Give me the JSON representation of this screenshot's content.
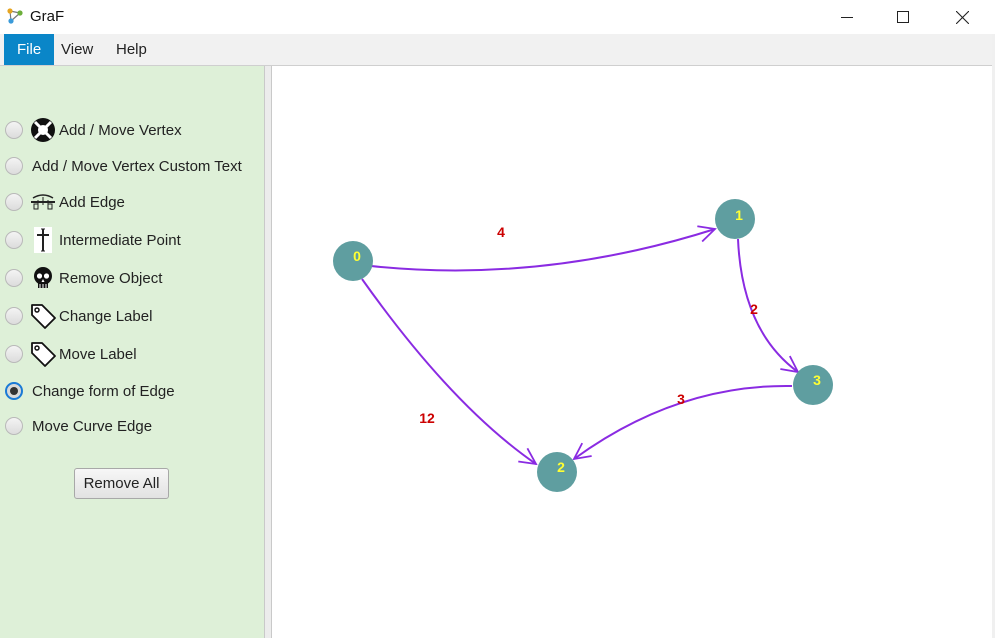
{
  "window": {
    "title": "GraF"
  },
  "menu": [
    {
      "label": "File",
      "active": true
    },
    {
      "label": "View",
      "active": false
    },
    {
      "label": "Help",
      "active": false
    }
  ],
  "tools": [
    {
      "label": "Add / Move Vertex",
      "icon": "vertex-icon",
      "selected": false
    },
    {
      "label": "Add / Move Vertex Custom Text",
      "icon": null,
      "selected": false
    },
    {
      "label": "Add Edge",
      "icon": "edge-icon",
      "selected": false
    },
    {
      "label": "Intermediate Point",
      "icon": "cross-icon",
      "selected": false
    },
    {
      "label": "Remove Object",
      "icon": "skull-icon",
      "selected": false
    },
    {
      "label": "Change Label",
      "icon": "tag-icon",
      "selected": false
    },
    {
      "label": "Move Label",
      "icon": "tag-icon",
      "selected": false
    },
    {
      "label": "Change form of Edge",
      "icon": null,
      "selected": true
    },
    {
      "label": "Move Curve Edge",
      "icon": null,
      "selected": false
    }
  ],
  "remove_all_label": "Remove All",
  "graph": {
    "vertices": [
      "0",
      "1",
      "2",
      "3"
    ],
    "edges": [
      {
        "from": "0",
        "to": "1",
        "label": "4"
      },
      {
        "from": "1",
        "to": "3",
        "label": "2"
      },
      {
        "from": "3",
        "to": "2",
        "label": "3"
      },
      {
        "from": "0",
        "to": "2",
        "label": "12"
      }
    ],
    "colors": {
      "vertex": "#5f9ea0",
      "vertex_text": "#ffff33",
      "edge": "#8a2be2",
      "edge_label": "#cc0000"
    }
  }
}
